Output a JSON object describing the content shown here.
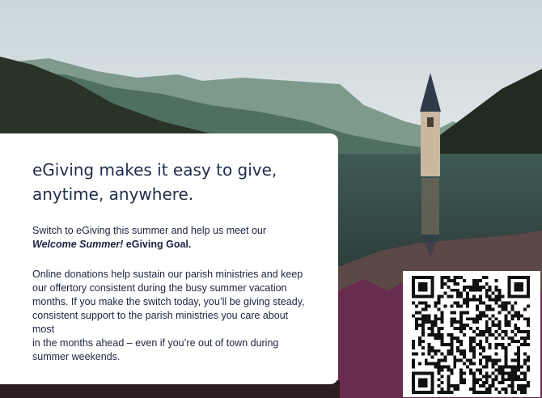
{
  "card": {
    "headline_line1": "eGiving makes it easy to give,",
    "headline_line2": "anytime, anywhere.",
    "intro_line1": "Switch to eGiving this summer and help us meet our",
    "intro_goal_italic": "Welcome Summer!",
    "intro_goal_rest": " eGiving Goal.",
    "body_lines": [
      "Online donations help sustain our parish ministries and keep",
      "our offertory consistent during the busy summer vacation",
      "months. If you make the switch today, you’ll be giving steady,",
      "consistent support to the parish ministries you care about most",
      "in the months ahead – even if you’re out of town during",
      "summer weekends."
    ]
  },
  "colors": {
    "headline": "#1f2c4a",
    "body_text": "#1c2340",
    "card_bg": "#ffffff"
  },
  "icons": {
    "qr": "qr-code-icon",
    "tower": "church-tower-illustration"
  }
}
